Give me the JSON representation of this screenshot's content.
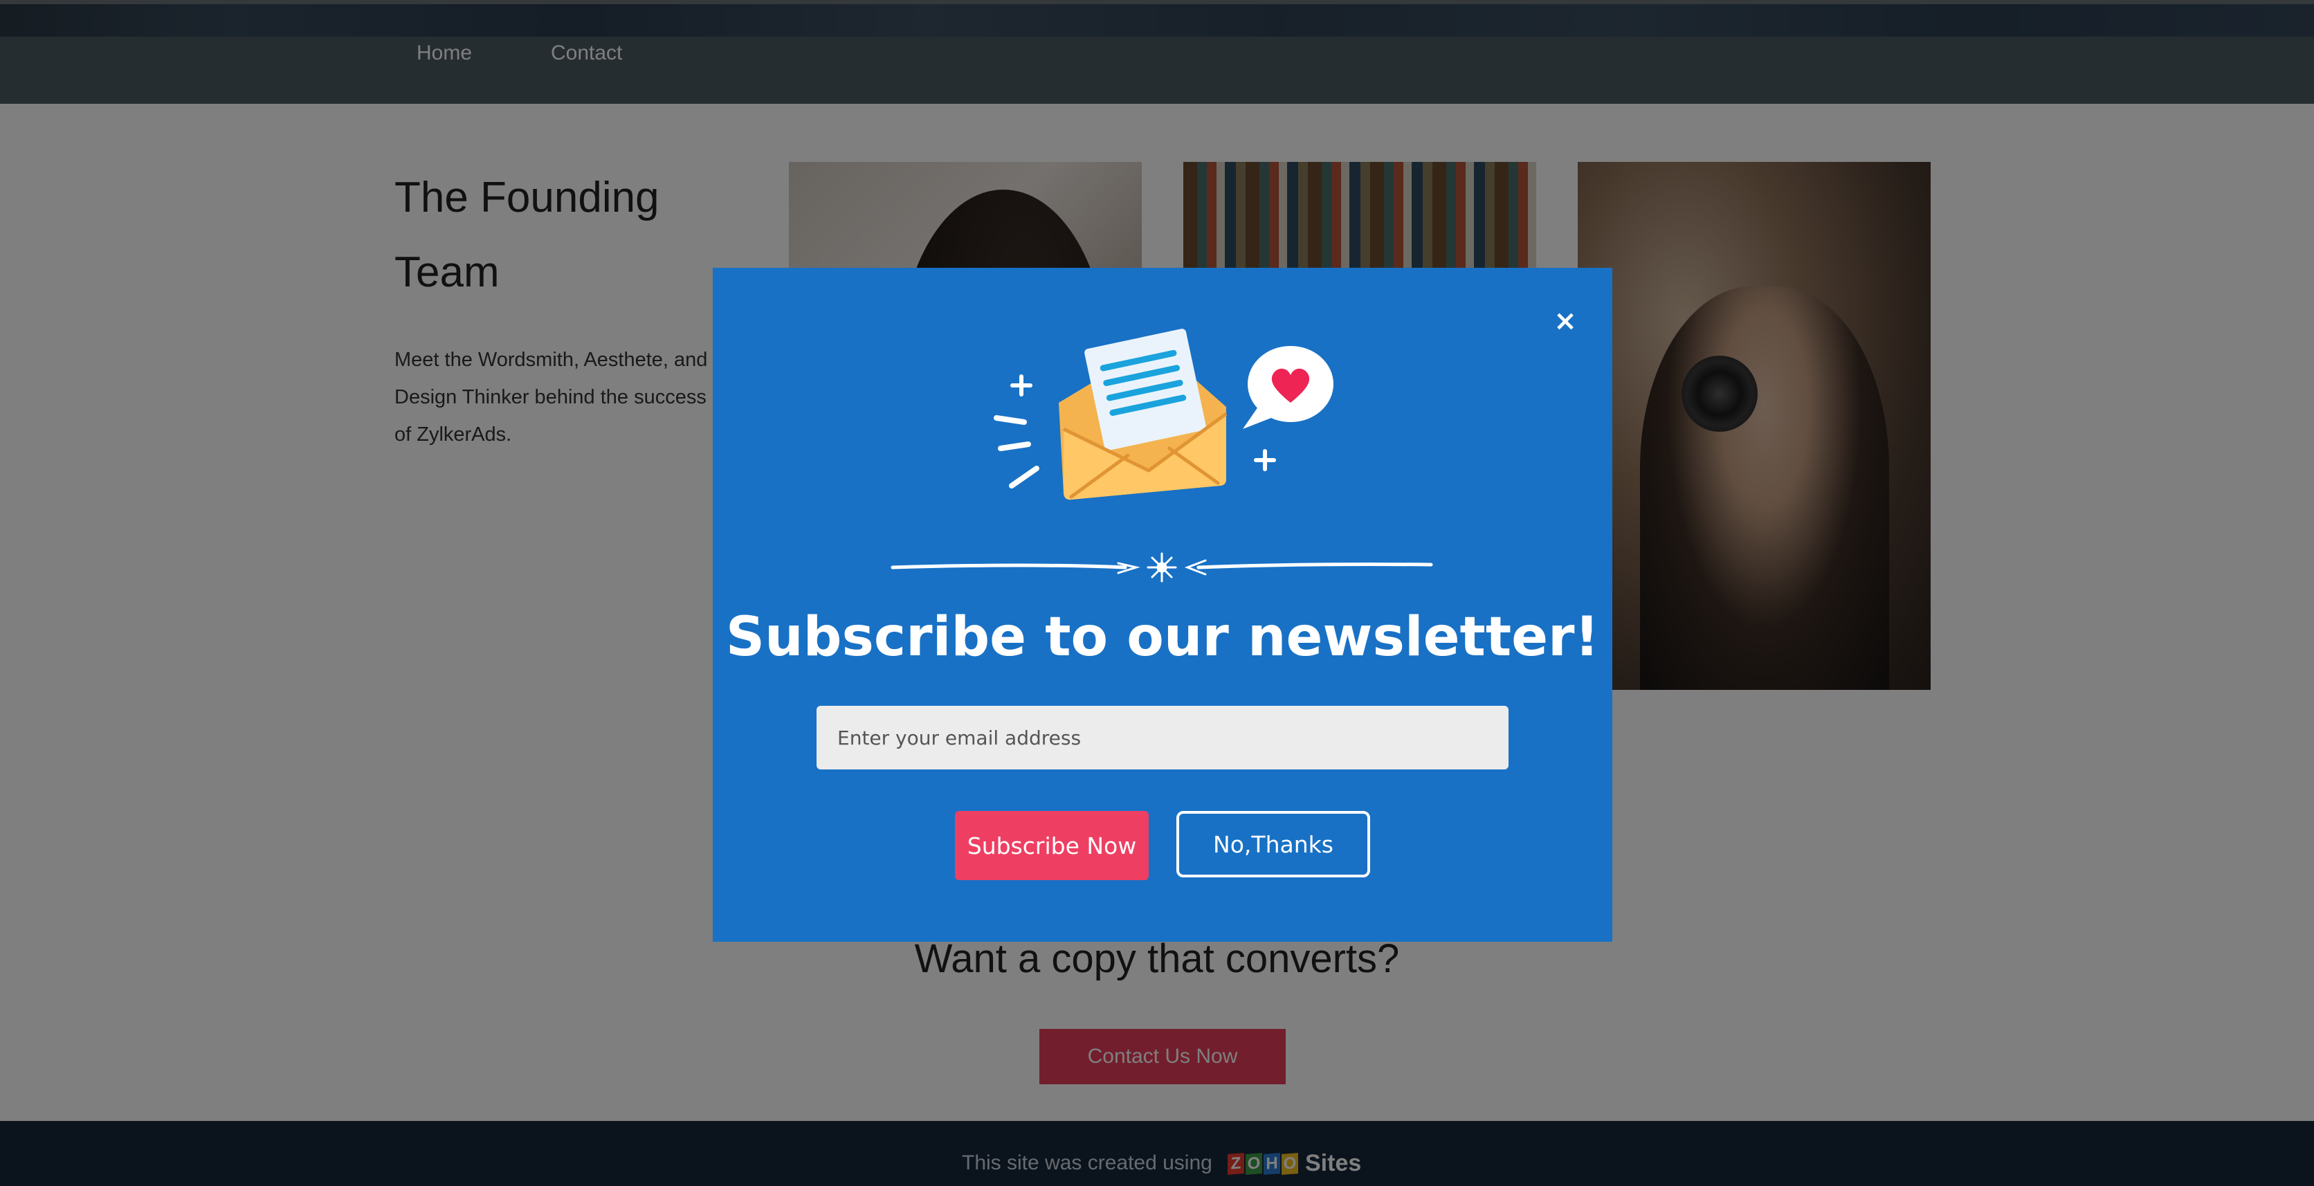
{
  "nav": {
    "home_label": "Home",
    "contact_label": "Contact"
  },
  "about": {
    "title": "The Founding Team",
    "description": "Meet the Wordsmith, Aesthete, and Design Thinker behind the success of ZylkerAds."
  },
  "cta": {
    "heading": "Want a copy that converts?",
    "button_label": "Contact Us Now"
  },
  "footer": {
    "created_text": "This site was created using",
    "brand_letters": [
      "Z",
      "O",
      "H",
      "O"
    ],
    "brand_suffix": "Sites"
  },
  "popup": {
    "close_symbol": "×",
    "title": "Subscribe to our newsletter!",
    "email_placeholder": "Enter your email address",
    "subscribe_label": "Subscribe Now",
    "decline_label": "No,Thanks"
  },
  "colors": {
    "modal_bg": "#1871c5",
    "subscribe_button": "#ee3f63",
    "cta_button": "#e73d5a",
    "footer_bg": "#17273b",
    "nav_bg": "#4d5a63"
  }
}
